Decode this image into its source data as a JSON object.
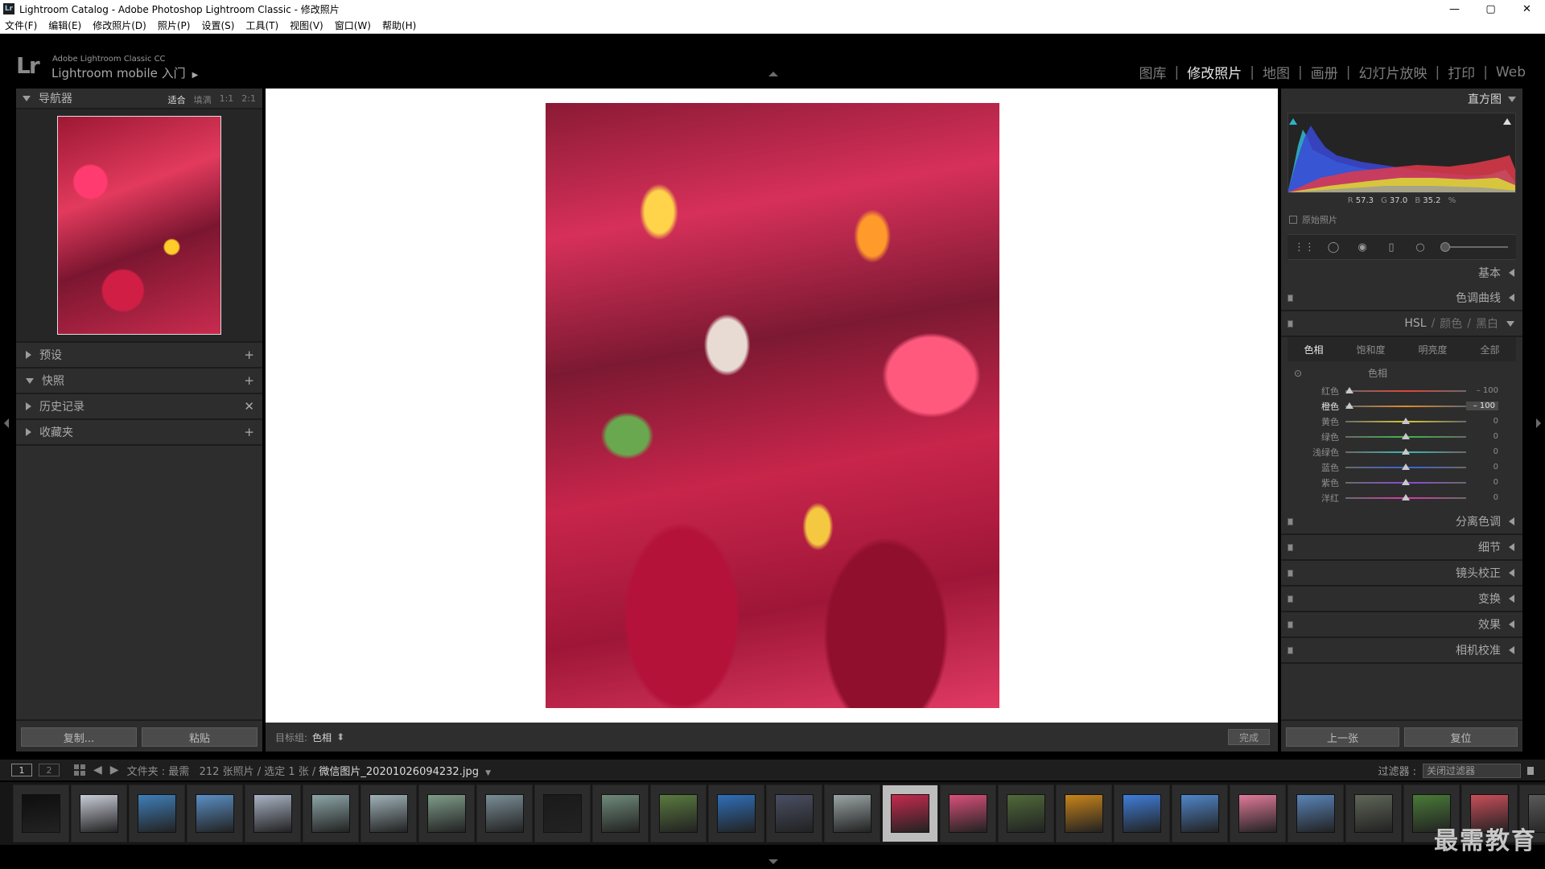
{
  "window": {
    "title": "Lightroom Catalog - Adobe Photoshop Lightroom Classic - 修改照片",
    "icon_label": "Lr",
    "controls": [
      "—",
      "▢",
      "✕"
    ]
  },
  "menu": [
    "文件(F)",
    "编辑(E)",
    "修改照片(D)",
    "照片(P)",
    "设置(S)",
    "工具(T)",
    "视图(V)",
    "窗口(W)",
    "帮助(H)"
  ],
  "header": {
    "logo": "Lr",
    "product": "Adobe Lightroom Classic CC",
    "mobile": "Lightroom mobile 入门",
    "modules": [
      "图库",
      "修改照片",
      "地图",
      "画册",
      "幻灯片放映",
      "打印",
      "Web"
    ],
    "active_module": "修改照片"
  },
  "left_panel": {
    "navigator": {
      "title": "导航器",
      "zoom_options": [
        "适合",
        "填满",
        "1:1",
        "2:1"
      ],
      "active_zoom": "适合"
    },
    "sections": [
      {
        "label": "预设",
        "action": "+",
        "expanded": false
      },
      {
        "label": "快照",
        "action": "+",
        "expanded": true
      },
      {
        "label": "历史记录",
        "action": "✕",
        "expanded": false
      },
      {
        "label": "收藏夹",
        "action": "+",
        "expanded": false
      }
    ],
    "copy_button": "复制...",
    "paste_button": "粘贴"
  },
  "center": {
    "target_label": "目标组:",
    "target_value": "色相",
    "done_button": "完成"
  },
  "right_panel": {
    "histogram_title": "直方图",
    "rgb": {
      "r_label": "R",
      "r": "57.3",
      "g_label": "G",
      "g": "37.0",
      "b_label": "B",
      "b": "35.2",
      "unit": "%"
    },
    "original_photo": "原始照片",
    "sections_top": [
      "基本",
      "色调曲线"
    ],
    "hsl_head": {
      "hsl": "HSL",
      "color": "颜色",
      "bw": "黑白"
    },
    "hsl_tabs": [
      "色相",
      "饱和度",
      "明亮度",
      "全部"
    ],
    "active_hsl_tab": "色相",
    "hsl_group_title": "色相",
    "hue_sliders": [
      {
        "name": "红色",
        "value": "– 100",
        "level": 0.0,
        "color": "#e0453a"
      },
      {
        "name": "橙色",
        "value": "– 100",
        "level": 0.0,
        "color": "#e08a2a"
      },
      {
        "name": "黄色",
        "value": "0",
        "level": 0.5,
        "color": "#d8c830"
      },
      {
        "name": "绿色",
        "value": "0",
        "level": 0.5,
        "color": "#3cb84a"
      },
      {
        "name": "浅绿色",
        "value": "0",
        "level": 0.5,
        "color": "#3ab8b0"
      },
      {
        "name": "蓝色",
        "value": "0",
        "level": 0.5,
        "color": "#3a62d8"
      },
      {
        "name": "紫色",
        "value": "0",
        "level": 0.5,
        "color": "#8a4ad8"
      },
      {
        "name": "洋红",
        "value": "0",
        "level": 0.5,
        "color": "#d83aa8"
      }
    ],
    "active_slider": "橙色",
    "sections_bottom": [
      "分离色调",
      "细节",
      "镜头校正",
      "变换",
      "效果",
      "相机校准"
    ],
    "prev_button": "上一张",
    "reset_button": "复位"
  },
  "filmstrip": {
    "page1": "1",
    "page2": "2",
    "path_label": "文件夹 : 最需",
    "count": "212 张照片 / 选定 1 张 /",
    "filename": "微信图片_20201026094232.jpg",
    "filter_label": "过滤器 :",
    "filter_value": "关闭过滤器",
    "selected_index": 15,
    "thumb_colors": [
      "#0e0e0e",
      "#c8ccd6",
      "#3f7fb8",
      "#5a8fc4",
      "#a9b3c4",
      "#8da6a8",
      "#9fb2b8",
      "#7f9c8a",
      "#7a8e96",
      "#1a1a1a",
      "#6f8a7a",
      "#5a7a3f",
      "#2f6fb8",
      "#4a4e62",
      "#9aa4a4",
      "#c52a4e",
      "#d8507a",
      "#4f6a3a",
      "#c8841a",
      "#3f7ed8",
      "#4f86c8",
      "#e07a9a",
      "#5a84b8",
      "#5f6658",
      "#4a7a38",
      "#c84e5a",
      "#5a5a5a"
    ]
  },
  "watermark": "最需教育"
}
